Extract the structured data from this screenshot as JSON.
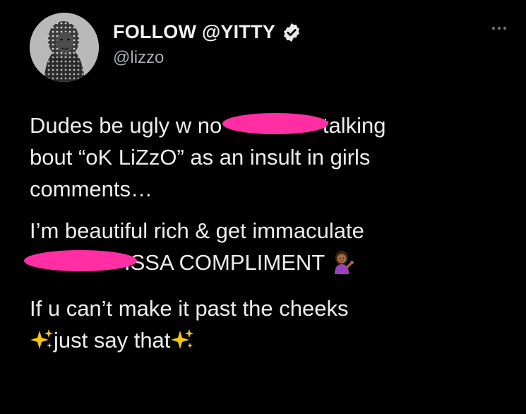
{
  "tweet": {
    "display_name": "FOLLOW @YITTY",
    "handle": "@lizzo",
    "verified_icon": "verified-badge-icon",
    "more_icon": "more-options-icon",
    "colors": {
      "background": "#000000",
      "text": "#ededed",
      "handle": "#a9adb1",
      "redaction": "#ff2fa3"
    },
    "paragraph1": {
      "line1_before": "Dudes be ugly w no",
      "line1_after": "talking",
      "line2": "bout “oK LiZzO” as an insult in girls",
      "line3": "comments…"
    },
    "paragraph2": {
      "line1": "I’m beautiful rich & get immaculate",
      "line2_after": "ISSA COMPLIMENT"
    },
    "paragraph3": {
      "line1": "If u can’t make it past the cheeks",
      "line2": "just say that"
    },
    "icons": {
      "shrug": "person-tipping-hand-emoji-icon",
      "sparkles": "sparkles-emoji-icon"
    }
  }
}
